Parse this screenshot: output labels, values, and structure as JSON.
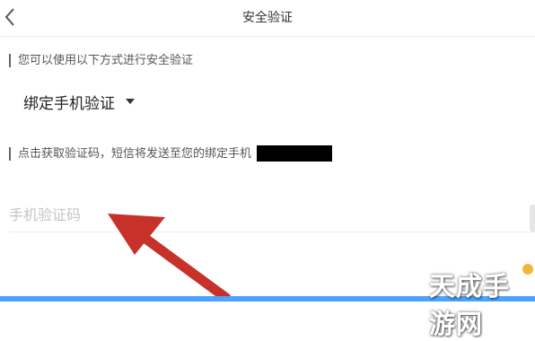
{
  "nav": {
    "title": "安全验证",
    "back_icon": "chevron-left-icon"
  },
  "section1": {
    "label": "您可以使用以下方式进行安全验证"
  },
  "method_select": {
    "selected": "绑定手机验证",
    "caret_icon": "caret-down-icon"
  },
  "section2": {
    "label": "点击获取验证码，短信将发送至您的绑定手机"
  },
  "code_input": {
    "placeholder": "手机验证码",
    "value": ""
  },
  "annotation": {
    "arrow_color": "#c8302a",
    "arrow_icon": "red-arrow-pointer"
  },
  "watermark": {
    "text": "天成手游网"
  },
  "colors": {
    "primary_button": "#4aa3ff",
    "mask": "#000000"
  }
}
